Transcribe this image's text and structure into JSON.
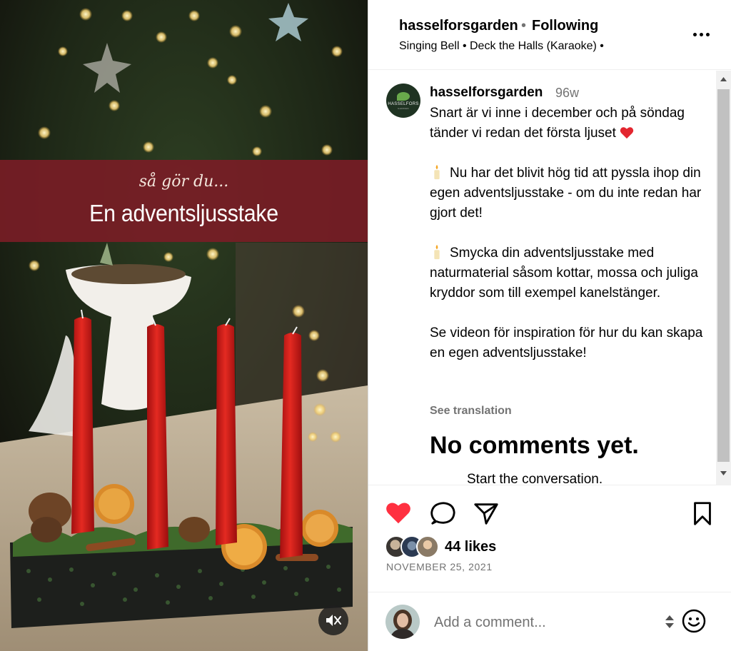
{
  "media": {
    "banner_subtitle": "så gör du...",
    "banner_title": "En adventsljusstake",
    "mute_icon": "muted-speaker-icon",
    "banner_color": "#7a1d26",
    "candle_color": "#d01b1b"
  },
  "header": {
    "username": "hasselforsgarden",
    "separator": "•",
    "follow_status": "Following",
    "audio": "Singing Bell • Deck the Halls (Karaoke) •",
    "more_icon": "more-options-icon"
  },
  "post": {
    "avatar_text": "HASSELFORS",
    "avatar_subtext": "GARDEN",
    "username": "hasselforsgarden",
    "time": "96w",
    "caption": {
      "p1": "Snart är vi inne i december och på söndag tänder vi redan det första ljuset",
      "p2": "Nu har det blivit hög tid att pyssla ihop din egen adventsljusstake - om du inte redan har gjort det!",
      "p3": "Smycka din adventsljusstake med naturmaterial såsom kottar, mossa och juliga kryddor som till exempel kanelstänger.",
      "p4": "Se videon för inspiration för hur du kan skapa en egen adventsljusstake!"
    },
    "see_translation": "See translation",
    "no_comments": "No comments yet.",
    "start_conversation": "Start the conversation."
  },
  "actions": {
    "liked": true,
    "like_color": "#ff3040",
    "likes": "44 likes",
    "date": "NOVEMBER 25, 2021"
  },
  "comment": {
    "placeholder": "Add a comment...",
    "emoji_icon": "emoji-icon"
  }
}
